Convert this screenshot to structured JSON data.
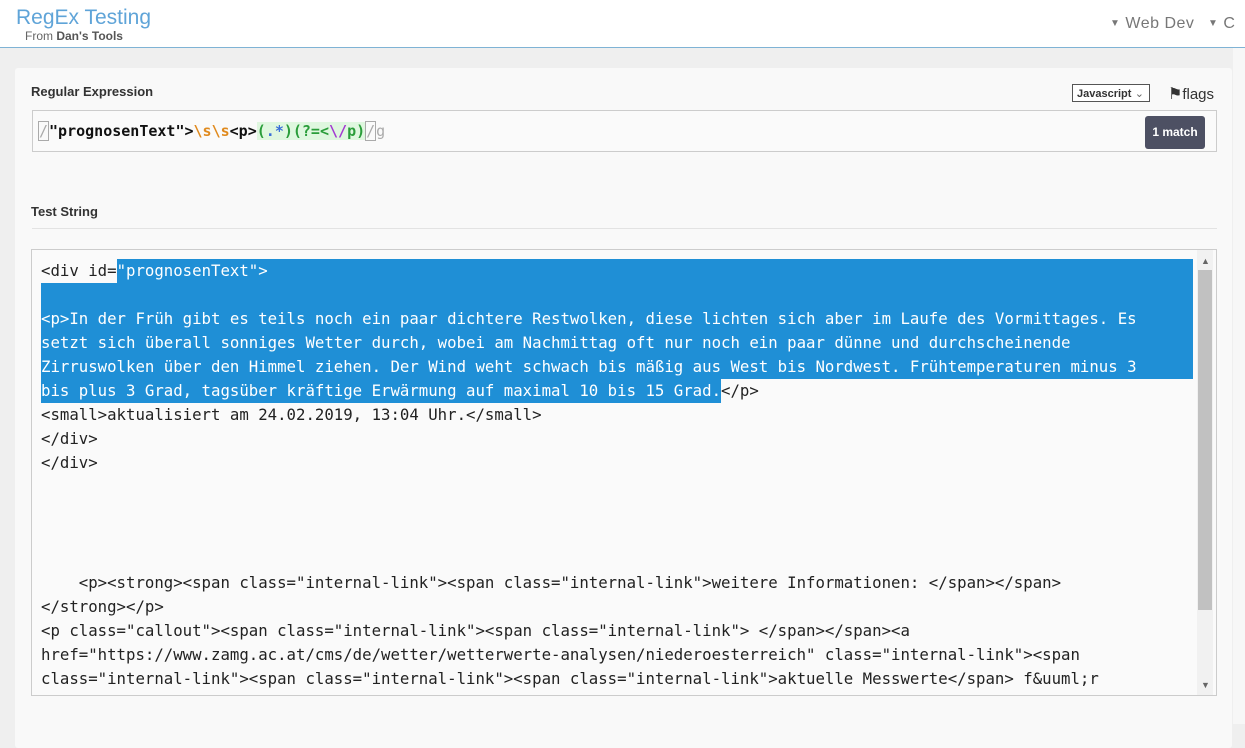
{
  "header": {
    "title": "RegEx Testing",
    "subtitle_prefix": "From",
    "subtitle_brand": "Dan's Tools",
    "nav": [
      "Web Dev",
      "C"
    ]
  },
  "regex_section": {
    "label": "Regular Expression",
    "flavor": "Javascript",
    "flags_label": "flags",
    "match_count": "1 match",
    "pattern": {
      "delim": "/",
      "lit1": "\"prognosenText\">",
      "esc1": "\\s\\s",
      "lit2": "<p>",
      "g1open": "(",
      "dot": ".",
      "star": "*",
      "g1close": ")",
      "look": "(?=<",
      "pesc": "\\/",
      "lit3": "p)",
      "flag": "g"
    }
  },
  "test_section": {
    "label": "Test String",
    "lines": [
      {
        "pre": "<div id=",
        "hl": "\"prognosenText\">"
      },
      {
        "full": ""
      },
      {
        "full": "<p>In der Früh gibt es teils noch ein paar dichtere Restwolken, diese lichten sich aber im Laufe des Vormittages. Es"
      },
      {
        "full": "setzt sich überall sonniges Wetter durch, wobei am Nachmittag oft nur noch ein paar dünne und durchscheinende"
      },
      {
        "full": "Zirruswolken über den Himmel ziehen. Der Wind weht schwach bis mäßig aus West bis Nordwest. Frühtemperaturen minus 3"
      },
      {
        "hl": "bis plus 3 Grad, tagsüber kräftige Erwärmung auf maximal 10 bis 15 Grad.",
        "post": "</p>"
      },
      {
        "text": "<small>aktualisiert am 24.02.2019, 13:04 Uhr.</small>"
      },
      {
        "text": "</div>"
      },
      {
        "text": "</div>"
      },
      {
        "text": ""
      },
      {
        "text": ""
      },
      {
        "text": ""
      },
      {
        "text": ""
      },
      {
        "text": "    <p><strong><span class=\"internal-link\"><span class=\"internal-link\">weitere Informationen: </span></span>"
      },
      {
        "text": "</strong></p>"
      },
      {
        "text": "<p class=\"callout\"><span class=\"internal-link\"><span class=\"internal-link\"> </span></span><a"
      },
      {
        "text": "href=\"https://www.zamg.ac.at/cms/de/wetter/wetterwerte-analysen/niederoesterreich\" class=\"internal-link\"><span"
      },
      {
        "text": "class=\"internal-link\"><span class=\"internal-link\"><span class=\"internal-link\">aktuelle Messwerte</span> f&uuml;r"
      }
    ]
  },
  "colors": {
    "accent": "#5fa4d8",
    "highlight": "#1f8fd6",
    "match_badge": "#4d5063"
  }
}
